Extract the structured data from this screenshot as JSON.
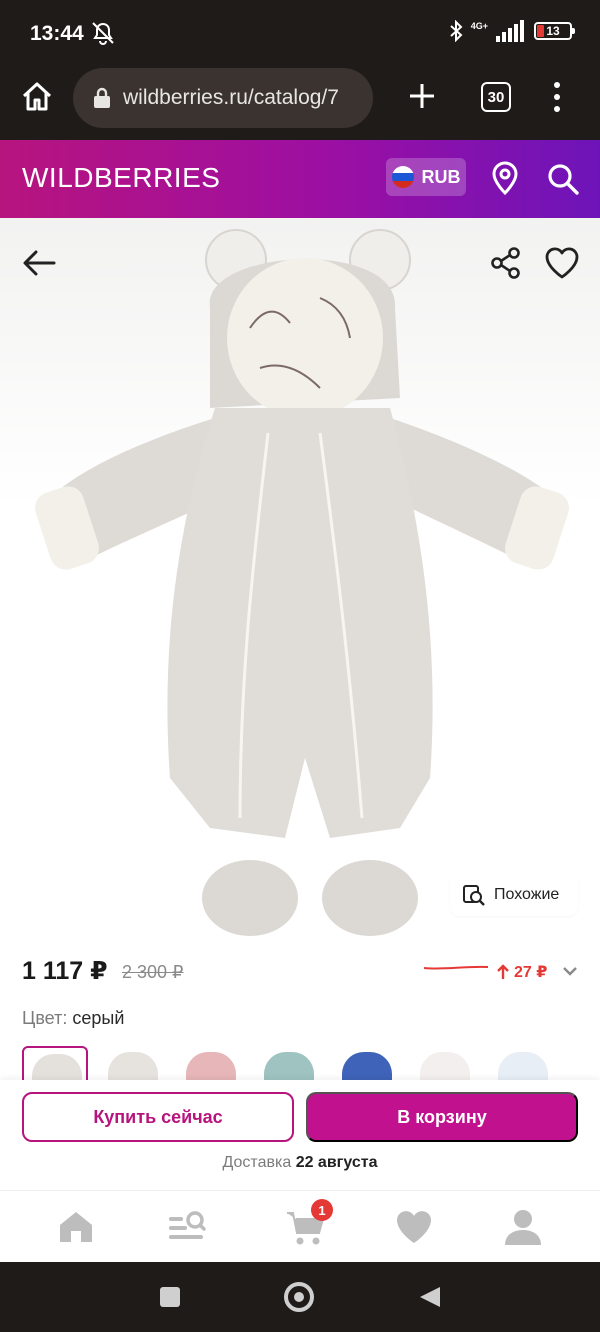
{
  "status_bar": {
    "time": "13:44",
    "network": "4G+",
    "battery": "13"
  },
  "browser": {
    "url": "wildberries.ru/catalog/7",
    "tab_count": "30"
  },
  "header": {
    "logo": "WILDBERRIES",
    "currency": "RUB",
    "brand_color": "#b7147e"
  },
  "product": {
    "similar_label": "Похожие",
    "price": "1 117 ₽",
    "old_price": "2 300 ₽",
    "price_change": "27 ₽",
    "color_label": "Цвет:",
    "color_value": "серый",
    "swatches": [
      {
        "color": "#e4e0dc"
      },
      {
        "color": "#e6e3df"
      },
      {
        "color": "#e6b6b8"
      },
      {
        "color": "#9fc3c0"
      },
      {
        "color": "#3f63b8"
      },
      {
        "color": "#f4efef"
      },
      {
        "color": "#e8eef6"
      }
    ]
  },
  "actions": {
    "buy_now": "Купить сейчас",
    "add_to_cart": "В корзину",
    "delivery_label": "Доставка",
    "delivery_date": "22 августа"
  },
  "bottom_nav": {
    "cart_badge": "1",
    "items": [
      "home-icon",
      "catalog-search-icon",
      "cart-icon",
      "favorites-icon",
      "profile-icon"
    ]
  }
}
